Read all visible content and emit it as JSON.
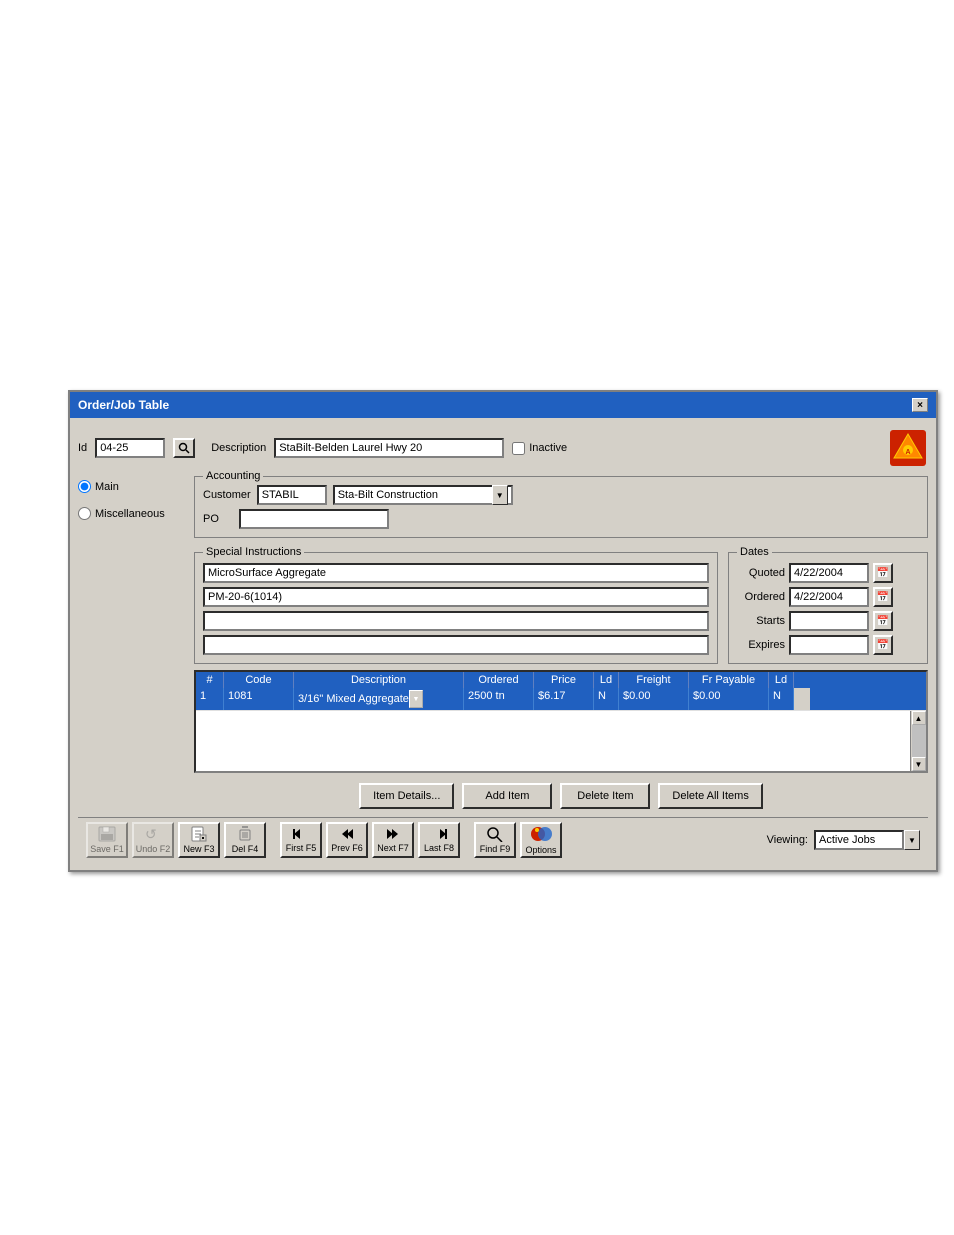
{
  "window": {
    "title": "Order/Job Table",
    "close_label": "×"
  },
  "header": {
    "id_label": "Id",
    "id_value": "04-25",
    "description_label": "Description",
    "description_value": "StaBilt-Belden Laurel Hwy 20",
    "inactive_label": "Inactive"
  },
  "radio": {
    "main_label": "Main",
    "miscellaneous_label": "Miscellaneous"
  },
  "accounting": {
    "group_title": "Accounting",
    "customer_label": "Customer",
    "customer_code": "STABIL",
    "customer_name": "Sta-Bilt Construction",
    "po_label": "PO",
    "po_value": ""
  },
  "special_instructions": {
    "group_title": "Special Instructions",
    "line1": "MicroSurface Aggregate",
    "line2": "PM-20-6(1014)",
    "line3": "",
    "line4": ""
  },
  "dates": {
    "group_title": "Dates",
    "quoted_label": "Quoted",
    "quoted_value": "4/22/2004",
    "ordered_label": "Ordered",
    "ordered_value": "4/22/2004",
    "starts_label": "Starts",
    "starts_value": "",
    "expires_label": "Expires",
    "expires_value": ""
  },
  "grid": {
    "columns": [
      "#",
      "Code",
      "Description",
      "Ordered",
      "Price",
      "Ld",
      "Freight",
      "Fr Payable",
      "Ld"
    ],
    "rows": [
      {
        "num": "1",
        "code": "1081",
        "description": "3/16\" Mixed Aggregate",
        "ordered": "2500 tn",
        "price": "$6.17",
        "ld": "N",
        "freight": "$0.00",
        "fr_payable": "$0.00",
        "ld2": "N"
      }
    ]
  },
  "buttons": {
    "item_details": "Item Details...",
    "add_item": "Add Item",
    "delete_item": "Delete Item",
    "delete_all_items": "Delete All Items"
  },
  "toolbar": {
    "save_label": "Save F1",
    "undo_label": "Undo F2",
    "new_label": "New F3",
    "del_label": "Del F4",
    "first_label": "First F5",
    "prev_label": "Prev F6",
    "next_label": "Next F7",
    "last_label": "Last F8",
    "find_label": "Find F9",
    "options_label": "Options"
  },
  "viewing": {
    "label": "Viewing:",
    "value": "Active Jobs"
  },
  "links": {
    "top": "",
    "bottom": ""
  }
}
